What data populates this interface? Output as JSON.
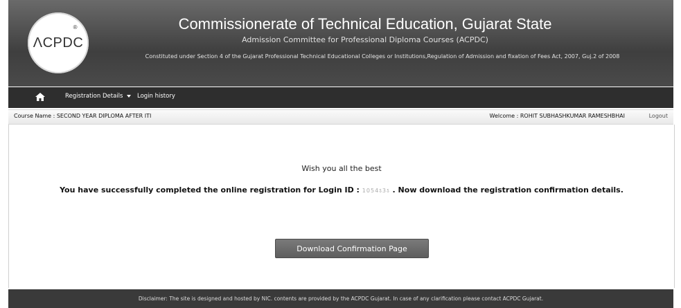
{
  "header": {
    "logo_text": "ΛCPDC",
    "logo_mark": "®",
    "title": "Commissionerate of Technical Education, Gujarat State",
    "subtitle": "Admission Committee for Professional Diploma Courses (ACPDC)",
    "description": "Constituted under Section 4 of the Gujarat Professional Technical Educational Colleges or Institutions,Regulation of Admission and fixation of Fees Act, 2007, Guj.2 of 2008"
  },
  "nav": {
    "home_icon": "home-icon",
    "items": [
      {
        "label": "Registration Details"
      },
      {
        "label": "Login history"
      }
    ]
  },
  "infobar": {
    "course": "Course Name : SECOND YEAR DIPLOMA AFTER ITI",
    "welcome": "Welcome : ROHIT SUBHASHKUMAR RAMESHBHAI",
    "logout": "Logout"
  },
  "content": {
    "wish": "Wish you all the best",
    "msg_before": "You have successfully completed the online registration for Login ID : ",
    "login_id": "1054ऽ3ऽ",
    "msg_after": " . Now download the registration confirmation details.",
    "download_button": "Download Confirmation Page"
  },
  "footer": {
    "disclaimer": "Disclaimer: The site is designed and hosted by NIC. contents are provided by the ACPDC Gujarat. In case of any clarification please contact ACPDC Gujarat."
  }
}
